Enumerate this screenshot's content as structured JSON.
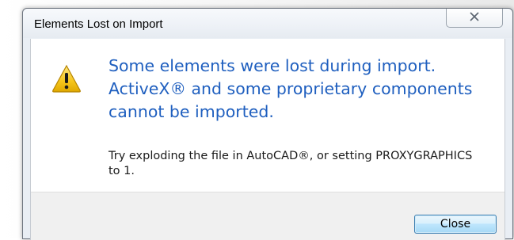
{
  "dialog": {
    "title": "Elements Lost on Import",
    "close_icon_glyph": "☒",
    "icon": "warning-icon",
    "headline": "Some elements were lost during import. ActiveX® and some proprietary components cannot be imported.",
    "detail": "Try exploding the file in AutoCAD®, or setting PROXYGRAPHICS to 1.",
    "close_button_label": "Close"
  },
  "colors": {
    "headline_blue": "#1f5fbf",
    "button_border": "#3c7fb1",
    "warning_yellow": "#f5c51b"
  }
}
